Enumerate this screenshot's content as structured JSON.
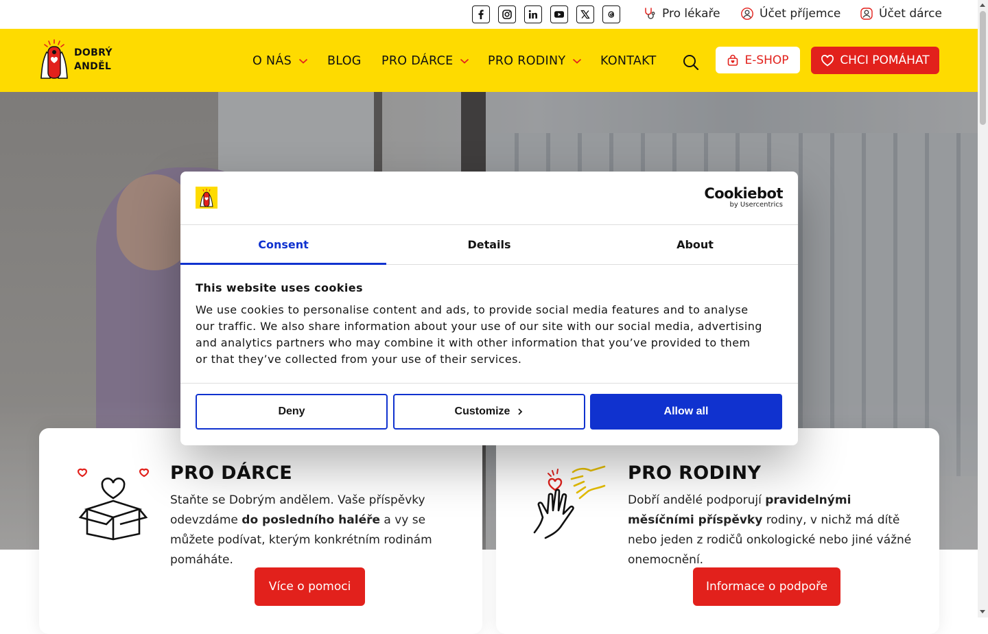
{
  "topbar": {
    "social_icons": [
      "facebook-icon",
      "instagram-icon",
      "linkedin-icon",
      "youtube-icon",
      "x-icon",
      "threads-icon"
    ],
    "pro_lekare": "Pro lékaře",
    "ucet_prijemce": "Účet příjemce",
    "ucet_darce": "Účet dárce"
  },
  "header": {
    "logo_line1": "DOBRÝ",
    "logo_line2": "ANDĚL",
    "nav": {
      "o_nas": "O NÁS",
      "blog": "BLOG",
      "pro_darce": "PRO DÁRCE",
      "pro_rodiny": "PRO RODINY",
      "kontakt": "KONTAKT"
    },
    "eshop_label": "E-SHOP",
    "help_label": "CHCI POMÁHAT"
  },
  "cards": {
    "darce": {
      "title": "PRO DÁRCE",
      "text_1": "Staňte se Dobrým andělem. Vaše příspěvky odevzdáme ",
      "text_bold": "do posledního haléře",
      "text_2": " a vy se můžete podívat, kterým konkrétním rodinám pomáháte.",
      "button": "Více o pomoci"
    },
    "rodiny": {
      "title": "PRO RODINY",
      "text_1": "Dobří andělé podporují ",
      "text_bold": "pravidelnými měsíčními příspěvky",
      "text_2": " rodiny, v nichž má dítě nebo jeden z rodičů onkologické nebo jiné vážné onemocnění.",
      "button": "Informace o podpoře"
    }
  },
  "cookie_dialog": {
    "brand": "Cookiebot",
    "brand_sub": "by Usercentrics",
    "tabs": {
      "consent": "Consent",
      "details": "Details",
      "about": "About"
    },
    "active_tab": "consent",
    "title": "This website uses cookies",
    "text": "We use cookies to personalise content and ads, to provide social media features and to analyse our traffic. We also share information about your use of our site with our social media, advertising and analytics partners who may combine it with other information that you’ve provided to them or that they’ve collected from your use of their services.",
    "deny": "Deny",
    "customize": "Customize",
    "allow_all": "Allow all"
  },
  "colors": {
    "brand_yellow": "#fedb00",
    "brand_red": "#e2211c",
    "cookiebot_blue": "#1032cf"
  }
}
